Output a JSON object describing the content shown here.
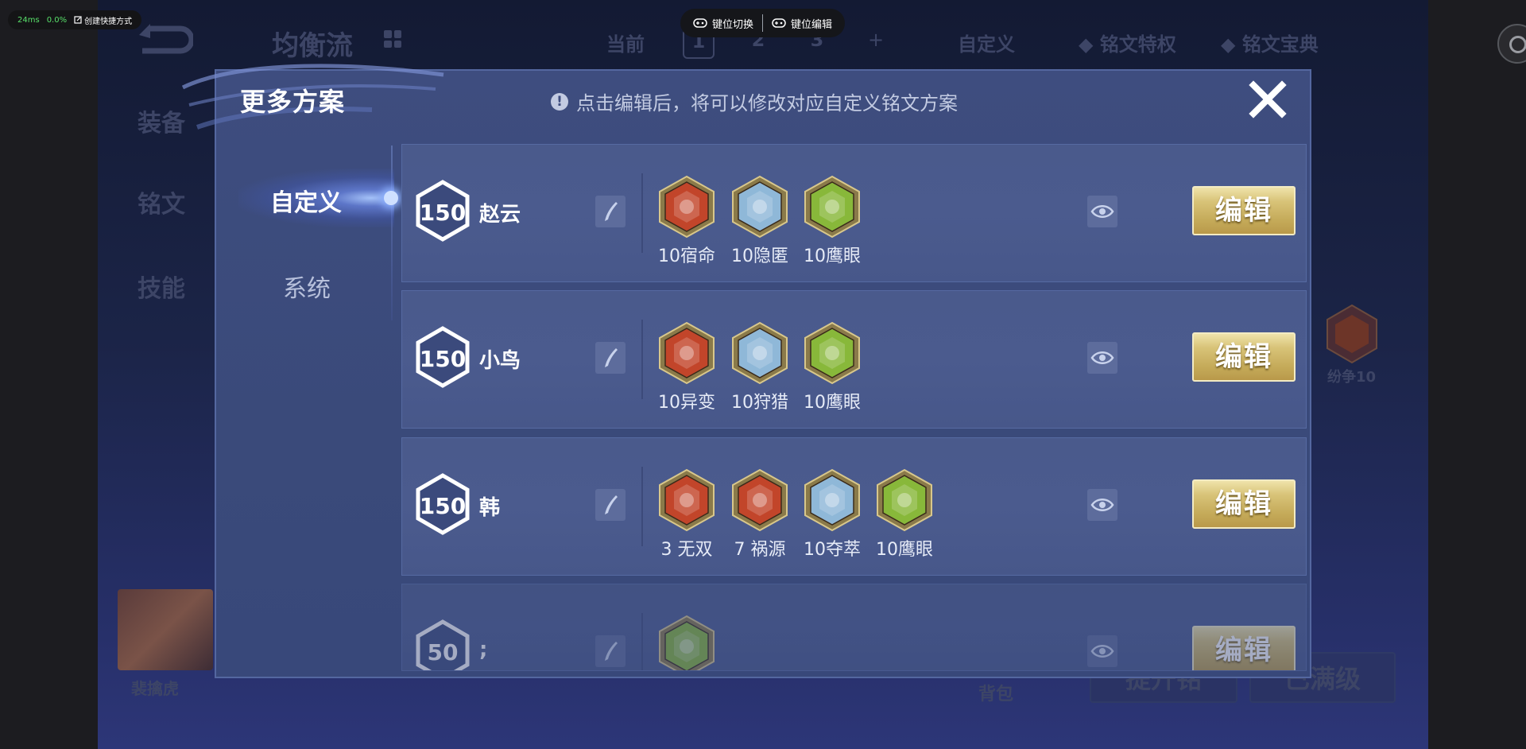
{
  "emulator": {
    "latency": "24ms",
    "cpu": "0.0%",
    "shortcut_label": "创建快捷方式",
    "key_switch": "键位切换",
    "key_edit": "键位编辑"
  },
  "background": {
    "mode_title": "均衡流",
    "current_label": "当前",
    "tabs": [
      "1",
      "2",
      "3",
      "+"
    ],
    "custom_label": "自定义",
    "privilege_label": "铭文特权",
    "codex_label": "铭文宝典",
    "side_menu": [
      "装备",
      "铭文",
      "技能"
    ],
    "hero_name": "裴擒虎",
    "backpack": "背包",
    "btn_left": "提升铭",
    "btn_right": "已满级",
    "rune_caption": "纷争10"
  },
  "modal": {
    "title": "更多方案",
    "hint": "点击编辑后，将可以修改对应自定义铭文方案",
    "nav": {
      "custom": "自定义",
      "system": "系统"
    },
    "edit_label": "编辑",
    "presets": [
      {
        "level": "150",
        "name": "赵云",
        "runes": [
          {
            "label": "10宿命",
            "color": "#c2452a",
            "icon": "flame-rune-icon"
          },
          {
            "label": "10隐匿",
            "color": "#8fb8d8",
            "icon": "droplet-rune-icon"
          },
          {
            "label": "10鹰眼",
            "color": "#88b83a",
            "icon": "clover-rune-icon"
          }
        ]
      },
      {
        "level": "150",
        "name": "小鸟",
        "runes": [
          {
            "label": "10异变",
            "color": "#c2452a",
            "icon": "helmet-rune-icon"
          },
          {
            "label": "10狩猎",
            "color": "#8fb8d8",
            "icon": "lightning-rune-icon"
          },
          {
            "label": "10鹰眼",
            "color": "#88b83a",
            "icon": "clover-rune-icon"
          }
        ]
      },
      {
        "level": "150",
        "name": "韩",
        "runes": [
          {
            "label": "3 无双",
            "color": "#c2452a",
            "icon": "diamond-rune-icon"
          },
          {
            "label": "7 祸源",
            "color": "#c2452a",
            "icon": "cards-rune-icon"
          },
          {
            "label": "10夺萃",
            "color": "#8fb8d8",
            "icon": "knot-rune-icon"
          },
          {
            "label": "10鹰眼",
            "color": "#88b83a",
            "icon": "clover-rune-icon"
          }
        ]
      },
      {
        "level": "50",
        "name": ";",
        "runes": [
          {
            "label": "",
            "color": "#88b83a",
            "icon": "star-rune-icon"
          }
        ]
      }
    ]
  }
}
